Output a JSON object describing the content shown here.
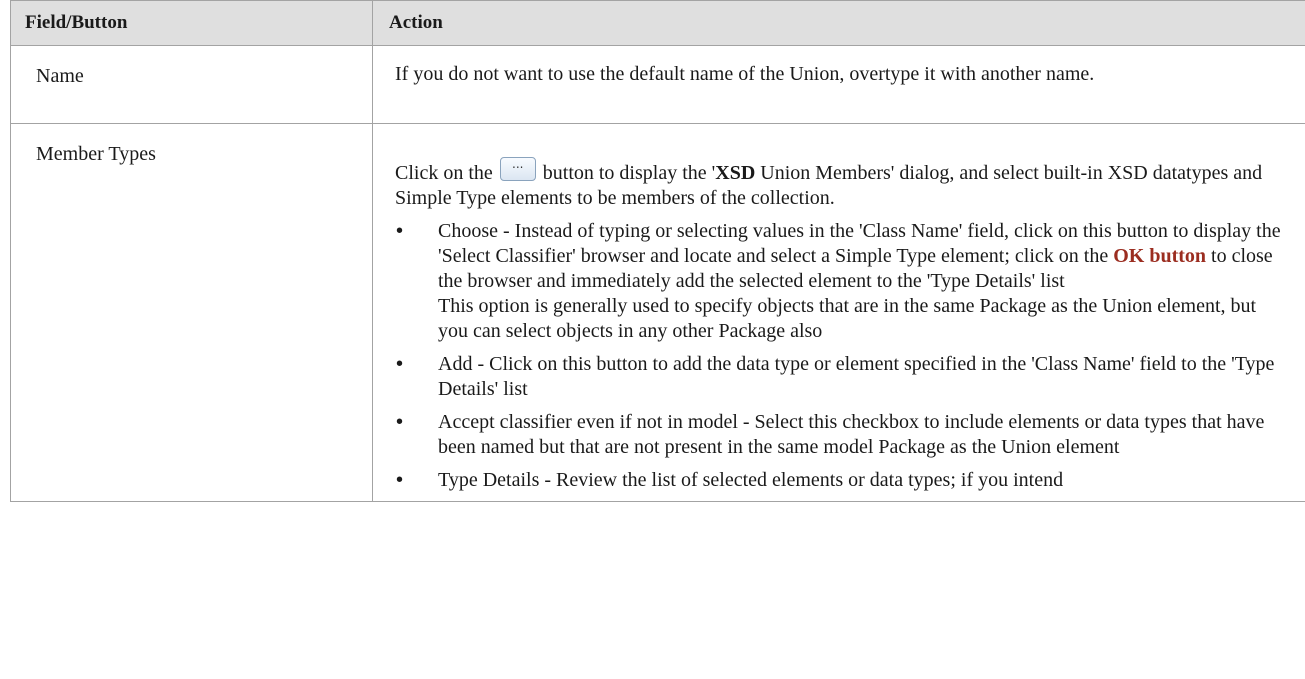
{
  "table": {
    "headers": {
      "field": "Field/Button",
      "action": "Action"
    },
    "name_row": {
      "field": "Name",
      "action": "If you do not want to use the default name of the Union, overtype it with another name."
    },
    "member_types_row": {
      "field": "Member Types",
      "intro_pre": "Click on the",
      "button_glyph": "...",
      "intro_mid": "button to display the '",
      "intro_bold": "XSD",
      "intro_post": " Union Members' dialog, and select built-in XSD datatypes and Simple Type elements to be members of the collection.",
      "bullets": {
        "choose_pre": "Choose - Instead of typing or selecting values in the 'Class Name' field, click on this button to display the 'Select Classifier' browser and locate and select a Simple Type element; click on the ",
        "choose_link": "OK button",
        "choose_post": " to close the browser and immediately add the selected element to the 'Type Details' list",
        "choose_note": "This option is generally used to specify objects that are in the same Package as the Union element, but you can select objects in any other Package also",
        "add": "Add - Click on this button to add the data type or element specified in the 'Class Name' field to the 'Type Details' list",
        "accept": "Accept classifier even if not in model - Select this checkbox to include elements or data types that have been named but that are not present in the same model Package as the Union element",
        "type_details": "Type Details - Review the list of selected elements or data types; if you intend"
      }
    }
  },
  "colors": {
    "header_bg": "#dfdfdf",
    "border": "#a3a3a3",
    "link": "#9b2d20"
  }
}
